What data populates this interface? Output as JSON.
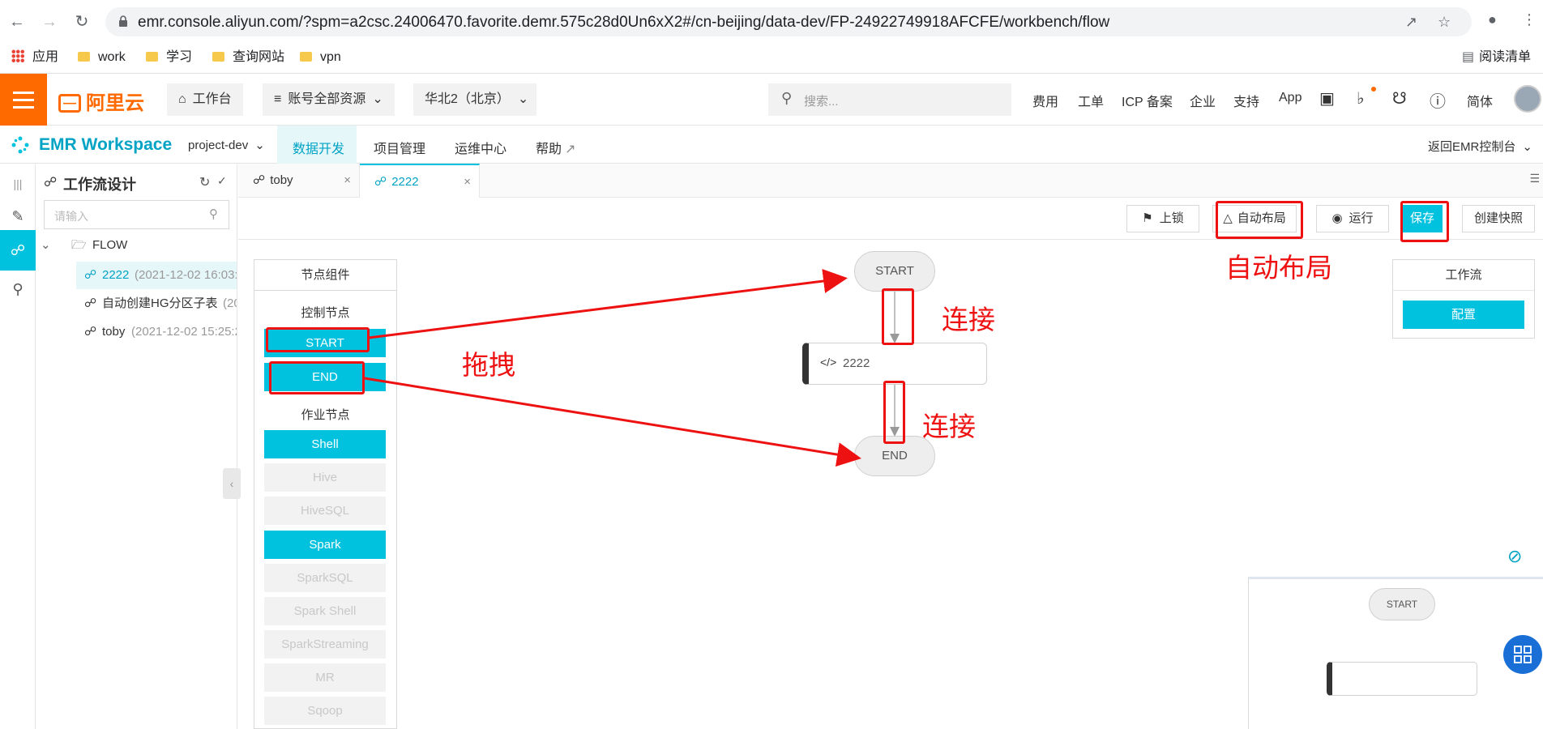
{
  "browser": {
    "url": "emr.console.aliyun.com/?spm=a2csc.24006470.favorite.demr.575c28d0Un6xX2#/cn-beijing/data-dev/FP-24922749918AFCFE/workbench/flow",
    "bookmarks": [
      {
        "label": "应用",
        "icon": "apps-icon"
      },
      {
        "label": "work",
        "icon": "folder-icon"
      },
      {
        "label": "学习",
        "icon": "folder-icon"
      },
      {
        "label": "查询网站",
        "icon": "folder-icon"
      },
      {
        "label": "vpn",
        "icon": "folder-icon"
      }
    ],
    "reading_list": "阅读清单"
  },
  "topbar": {
    "logo": "阿里云",
    "workbench": "工作台",
    "account_resources": "账号全部资源",
    "region": "华北2（北京）",
    "search_placeholder": "搜索...",
    "links": [
      "费用",
      "工单",
      "ICP 备案",
      "企业",
      "支持",
      "App"
    ],
    "lang": "简体",
    "brand_color": "#ff6a00"
  },
  "workspace": {
    "title": "EMR Workspace",
    "project": "project-dev",
    "menu": [
      "数据开发",
      "项目管理",
      "运维中心",
      "帮助"
    ],
    "back_link": "返回EMR控制台",
    "accent_color": "#00c1de"
  },
  "tree": {
    "title": "工作流设计",
    "search_placeholder": "请输入",
    "folder": "FLOW",
    "items": [
      {
        "name": "2222",
        "meta": "(2021-12-02 16:03:2",
        "selected": true
      },
      {
        "name": "自动创建HG分区子表",
        "meta": "(20",
        "selected": false
      },
      {
        "name": "toby",
        "meta": "(2021-12-02 15:25:2",
        "selected": false
      }
    ]
  },
  "editor": {
    "tabs": [
      {
        "label": "toby",
        "active": false
      },
      {
        "label": "2222",
        "active": true
      }
    ],
    "toolbar": {
      "lock": "上锁",
      "auto_layout": "自动布局",
      "run": "运行",
      "save": "保存",
      "snapshot": "创建快照"
    }
  },
  "palette": {
    "title": "节点组件",
    "control_section": "控制节点",
    "control_nodes": [
      "START",
      "END"
    ],
    "job_section": "作业节点",
    "job_nodes": [
      {
        "label": "Shell",
        "enabled": true
      },
      {
        "label": "Hive",
        "enabled": false
      },
      {
        "label": "HiveSQL",
        "enabled": false
      },
      {
        "label": "Spark",
        "enabled": true
      },
      {
        "label": "SparkSQL",
        "enabled": false
      },
      {
        "label": "Spark Shell",
        "enabled": false
      },
      {
        "label": "SparkStreaming",
        "enabled": false
      },
      {
        "label": "MR",
        "enabled": false
      },
      {
        "label": "Sqoop",
        "enabled": false
      }
    ]
  },
  "canvas": {
    "start": "START",
    "job": "2222",
    "end": "END"
  },
  "workflow_panel": {
    "title": "工作流",
    "config": "配置"
  },
  "minimap": {
    "start": "START"
  },
  "annotations": {
    "drag": "拖拽",
    "connect_1": "连接",
    "connect_2": "连接",
    "auto_layout": "自动布局"
  }
}
